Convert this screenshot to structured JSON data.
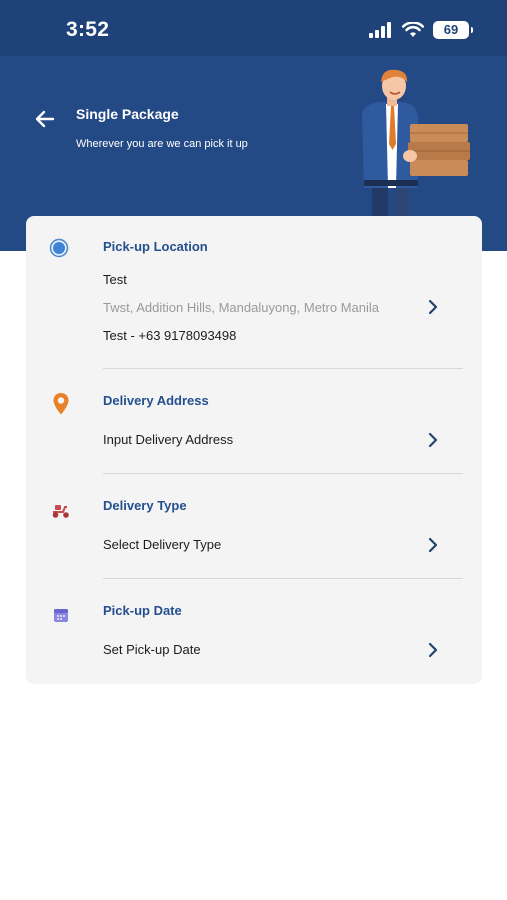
{
  "status_bar": {
    "time": "3:52",
    "battery": "69"
  },
  "header": {
    "title": "Single Package",
    "subtitle": "Wherever you are we can pick it up"
  },
  "pickup": {
    "label": "Pick-up Location",
    "name": "Test",
    "address": "Twst, Addition Hills, Mandaluyong, Metro Manila",
    "contact": "Test - +63 9178093498"
  },
  "delivery_address": {
    "label": "Delivery Address",
    "value": "Input Delivery Address"
  },
  "delivery_type": {
    "label": "Delivery Type",
    "value": "Select Delivery Type"
  },
  "pickup_date": {
    "label": "Pick-up Date",
    "value": "Set Pick-up Date"
  },
  "colors": {
    "header_blue": "#244a86",
    "status_blue": "#1f4278",
    "label_blue": "#24508f",
    "pin_orange": "#e8822a",
    "calendar_purple": "#8b86e0",
    "scooter_red": "#c94a4a",
    "card_bg": "#f4f4f4"
  },
  "icons": [
    "signal-icon",
    "wifi-icon",
    "battery-icon",
    "back-arrow-icon",
    "courier-illustration",
    "location-dot-icon",
    "map-pin-icon",
    "scooter-icon",
    "calendar-icon",
    "chevron-right-icon"
  ]
}
